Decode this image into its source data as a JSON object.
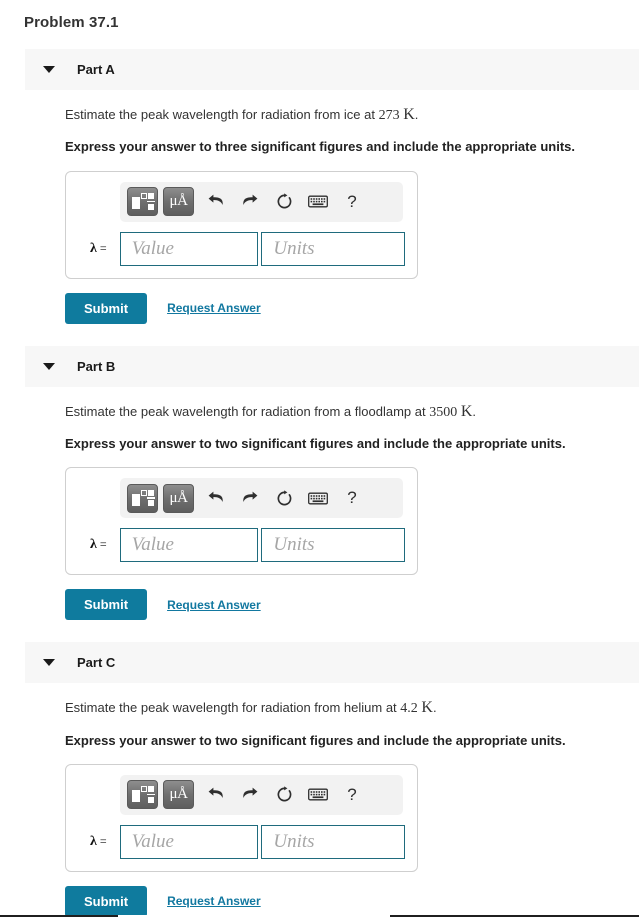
{
  "problem": {
    "title": "Problem 37.1"
  },
  "icons": {
    "caret": "caret-down-icon",
    "template": "math-template-icon",
    "units": "micro-angstrom-units-icon",
    "undo": "undo-arrow-icon",
    "redo": "redo-arrow-icon",
    "reset": "reset-circular-arrow-icon",
    "keyboard": "keyboard-icon",
    "help": "?"
  },
  "colors": {
    "submit_bg": "#0f7b9e",
    "link": "#1278a0",
    "field_border": "#1f6b7d",
    "header_bg": "#f7f7f7",
    "toolbar_bg": "#f2f2f2",
    "tool_button_bg": "#6f6f6f"
  },
  "toolbar": {
    "units_label_micro": "μ",
    "units_label_angstrom": "Å",
    "help_label": "?"
  },
  "answer_field": {
    "variable": "λ",
    "equals": "=",
    "value_placeholder": "Value",
    "units_placeholder": "Units",
    "value_text": "Value",
    "units_text": "Units"
  },
  "actions": {
    "submit_label": "Submit",
    "request_answer_label": "Request Answer"
  },
  "parts": [
    {
      "id": "part-a",
      "label": "Part A",
      "prompt_lead": "Estimate the peak wavelength for radiation from ice at ",
      "prompt_number": "273",
      "prompt_unit": "K",
      "prompt_tail": ".",
      "instruction": "Express your answer to three significant figures and include the appropriate units."
    },
    {
      "id": "part-b",
      "label": "Part B",
      "prompt_lead": "Estimate the peak wavelength for radiation from a floodlamp at ",
      "prompt_number": "3500",
      "prompt_unit": "K",
      "prompt_tail": ".",
      "instruction": "Express your answer to two significant figures and include the appropriate units."
    },
    {
      "id": "part-c",
      "label": "Part C",
      "prompt_lead": "Estimate the peak wavelength for radiation from helium at ",
      "prompt_number": "4.2",
      "prompt_unit": "K",
      "prompt_tail": ".",
      "instruction": "Express your answer to two significant figures and include the appropriate units."
    }
  ]
}
